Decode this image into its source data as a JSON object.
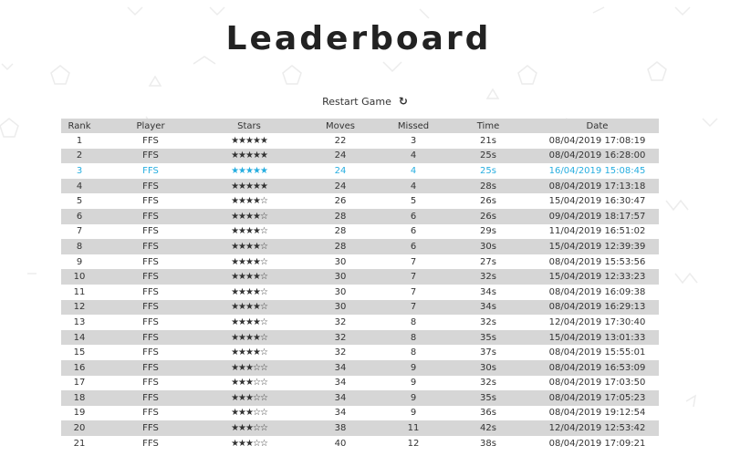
{
  "title": "Leaderboard",
  "restart": {
    "label": "Restart Game",
    "icon": "refresh-icon"
  },
  "colors": {
    "highlight": "#27aee0",
    "stripe": "#d6d6d6"
  },
  "table": {
    "headers": [
      "Rank",
      "Player",
      "Stars",
      "Moves",
      "Missed",
      "Time",
      "Date"
    ],
    "highlight_rank": "3",
    "rows": [
      {
        "rank": "1",
        "player": "FFS",
        "stars": 5,
        "moves": "22",
        "missed": "3",
        "time": "21s",
        "date": "08/04/2019 17:08:19"
      },
      {
        "rank": "2",
        "player": "FFS",
        "stars": 5,
        "moves": "24",
        "missed": "4",
        "time": "25s",
        "date": "08/04/2019 16:28:00"
      },
      {
        "rank": "3",
        "player": "FFS",
        "stars": 5,
        "moves": "24",
        "missed": "4",
        "time": "25s",
        "date": "16/04/2019 15:08:45"
      },
      {
        "rank": "4",
        "player": "FFS",
        "stars": 5,
        "moves": "24",
        "missed": "4",
        "time": "28s",
        "date": "08/04/2019 17:13:18"
      },
      {
        "rank": "5",
        "player": "FFS",
        "stars": 4,
        "moves": "26",
        "missed": "5",
        "time": "26s",
        "date": "15/04/2019 16:30:47"
      },
      {
        "rank": "6",
        "player": "FFS",
        "stars": 4,
        "moves": "28",
        "missed": "6",
        "time": "26s",
        "date": "09/04/2019 18:17:57"
      },
      {
        "rank": "7",
        "player": "FFS",
        "stars": 4,
        "moves": "28",
        "missed": "6",
        "time": "29s",
        "date": "11/04/2019 16:51:02"
      },
      {
        "rank": "8",
        "player": "FFS",
        "stars": 4,
        "moves": "28",
        "missed": "6",
        "time": "30s",
        "date": "15/04/2019 12:39:39"
      },
      {
        "rank": "9",
        "player": "FFS",
        "stars": 4,
        "moves": "30",
        "missed": "7",
        "time": "27s",
        "date": "08/04/2019 15:53:56"
      },
      {
        "rank": "10",
        "player": "FFS",
        "stars": 4,
        "moves": "30",
        "missed": "7",
        "time": "32s",
        "date": "15/04/2019 12:33:23"
      },
      {
        "rank": "11",
        "player": "FFS",
        "stars": 4,
        "moves": "30",
        "missed": "7",
        "time": "34s",
        "date": "08/04/2019 16:09:38"
      },
      {
        "rank": "12",
        "player": "FFS",
        "stars": 4,
        "moves": "30",
        "missed": "7",
        "time": "34s",
        "date": "08/04/2019 16:29:13"
      },
      {
        "rank": "13",
        "player": "FFS",
        "stars": 4,
        "moves": "32",
        "missed": "8",
        "time": "32s",
        "date": "12/04/2019 17:30:40"
      },
      {
        "rank": "14",
        "player": "FFS",
        "stars": 4,
        "moves": "32",
        "missed": "8",
        "time": "35s",
        "date": "15/04/2019 13:01:33"
      },
      {
        "rank": "15",
        "player": "FFS",
        "stars": 4,
        "moves": "32",
        "missed": "8",
        "time": "37s",
        "date": "08/04/2019 15:55:01"
      },
      {
        "rank": "16",
        "player": "FFS",
        "stars": 3,
        "moves": "34",
        "missed": "9",
        "time": "30s",
        "date": "08/04/2019 16:53:09"
      },
      {
        "rank": "17",
        "player": "FFS",
        "stars": 3,
        "moves": "34",
        "missed": "9",
        "time": "32s",
        "date": "08/04/2019 17:03:50"
      },
      {
        "rank": "18",
        "player": "FFS",
        "stars": 3,
        "moves": "34",
        "missed": "9",
        "time": "35s",
        "date": "08/04/2019 17:05:23"
      },
      {
        "rank": "19",
        "player": "FFS",
        "stars": 3,
        "moves": "34",
        "missed": "9",
        "time": "36s",
        "date": "08/04/2019 19:12:54"
      },
      {
        "rank": "20",
        "player": "FFS",
        "stars": 3,
        "moves": "38",
        "missed": "11",
        "time": "42s",
        "date": "12/04/2019 12:53:42"
      },
      {
        "rank": "21",
        "player": "FFS",
        "stars": 3,
        "moves": "40",
        "missed": "12",
        "time": "38s",
        "date": "08/04/2019 17:09:21"
      }
    ]
  }
}
